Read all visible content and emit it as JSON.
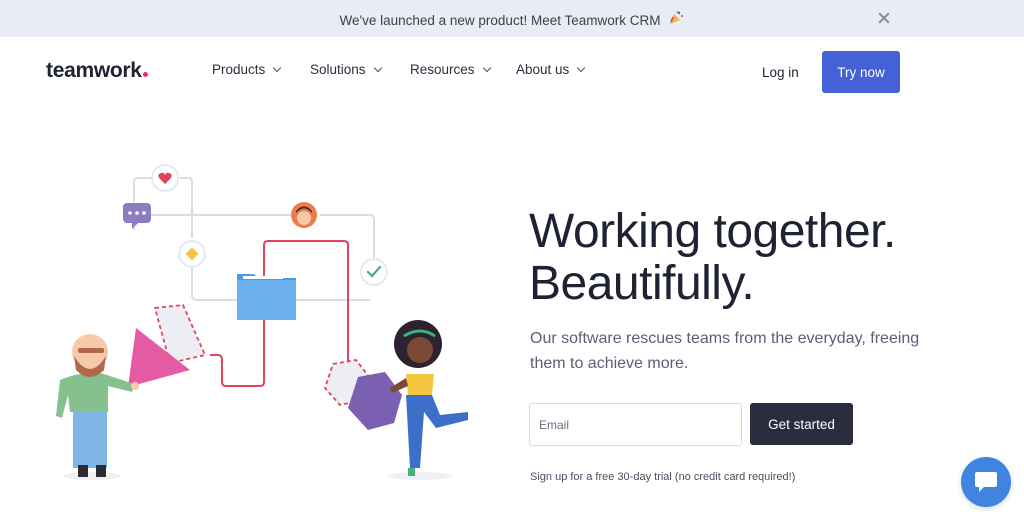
{
  "announcement": {
    "text": "We've launched a new product! Meet Teamwork CRM",
    "party_icon": "party-popper-icon",
    "close_icon": "close-icon"
  },
  "header": {
    "logo": "teamwork",
    "nav": [
      {
        "label": "Products"
      },
      {
        "label": "Solutions"
      },
      {
        "label": "Resources"
      },
      {
        "label": "About us"
      }
    ],
    "login": "Log in",
    "try_now": "Try now"
  },
  "hero": {
    "title_line1": "Working together.",
    "title_line2": "Beautifully.",
    "subtitle": "Our software rescues teams from the everyday, freeing them to achieve more.",
    "email_placeholder": "Email",
    "cta": "Get started",
    "trial_note": "Sign up for a free 30-day trial (no credit card required!)"
  },
  "chat": {
    "icon": "chat-bubble-icon"
  },
  "colors": {
    "accent_blue": "#4461d7",
    "dark_button": "#2a2d3e",
    "announce_bg": "#e8ecf3",
    "logo_dot": "#e6306d",
    "chat_blue": "#3e84e0"
  }
}
